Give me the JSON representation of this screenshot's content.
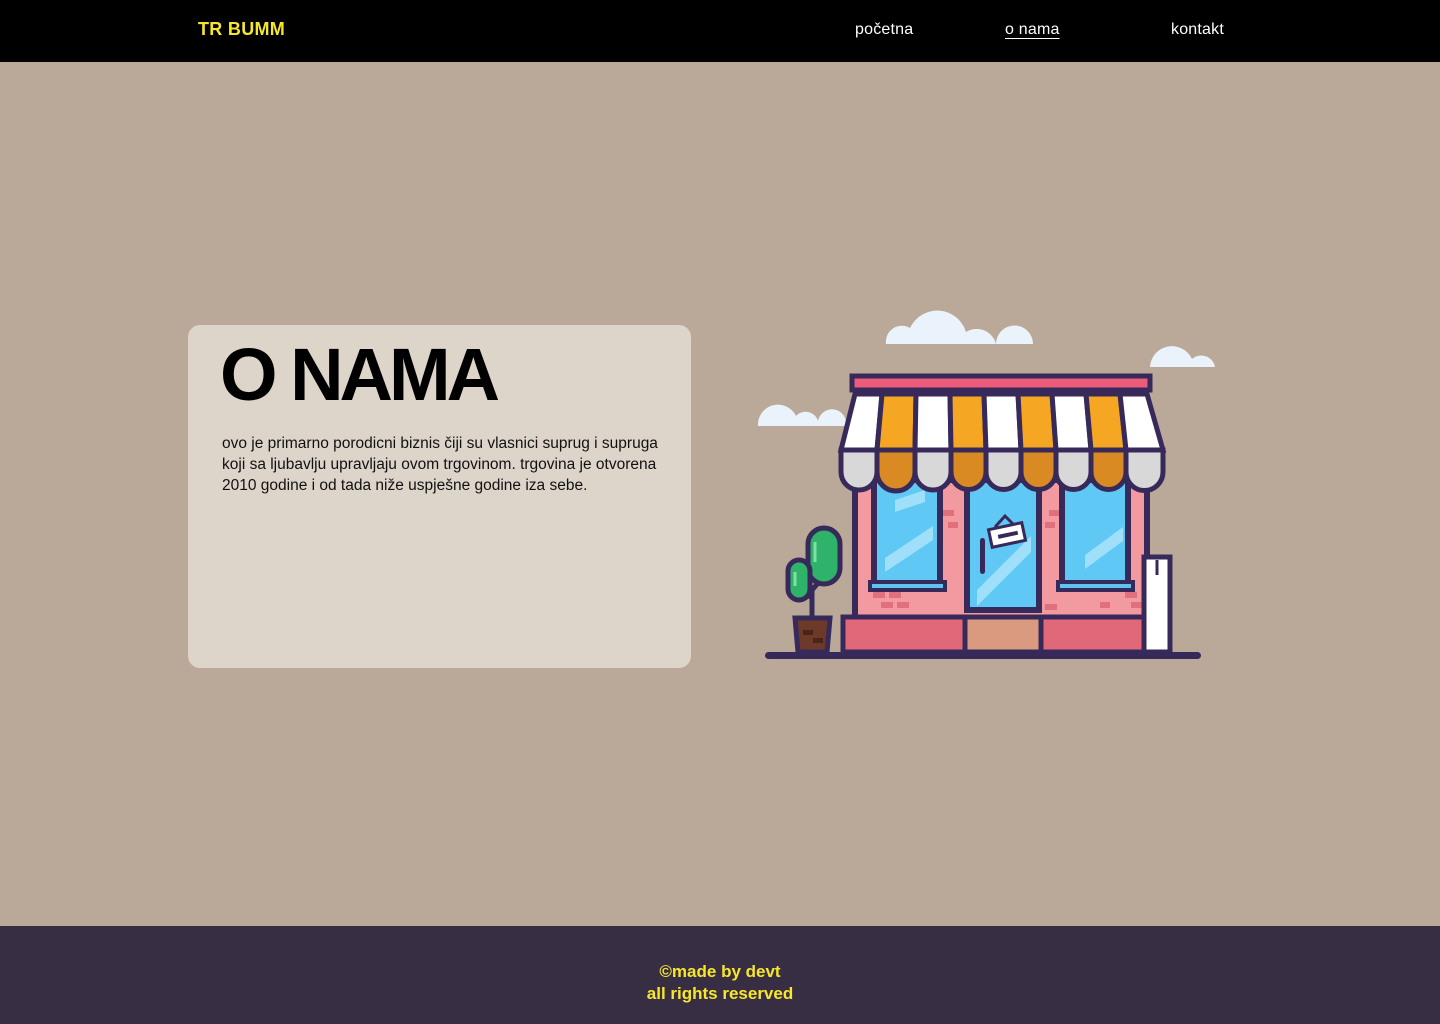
{
  "header": {
    "brand": "TR BUMM",
    "nav": [
      {
        "label": "početna",
        "active": false
      },
      {
        "label": "o nama",
        "active": true
      },
      {
        "label": "kontakt",
        "active": false
      }
    ]
  },
  "about": {
    "title": "O NAMA",
    "text": "ovo je primarno porodicni biznis čiji su vlasnici suprug i supruga koji sa ljubavlju upravljaju ovom trgovinom. trgovina je otvorena 2010 godine i od tada niže uspješne godine iza sebe."
  },
  "footer": {
    "line1": "©made by devt",
    "line2": "all rights reserved"
  },
  "colors": {
    "header_bg": "#000000",
    "brand": "#f7e72b",
    "page_bg": "#baa998",
    "card_bg": "#ddd4ca",
    "footer_bg": "#382e44",
    "footer_text": "#f7e72b"
  },
  "icons": {
    "illustration": "shop-storefront-illustration"
  }
}
